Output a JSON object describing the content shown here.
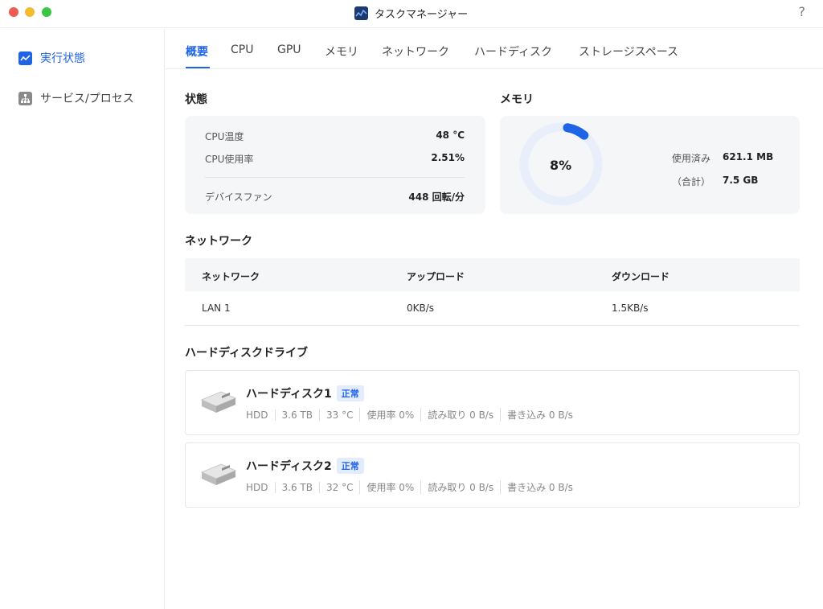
{
  "window": {
    "title": "タスクマネージャー",
    "help": "?"
  },
  "sidebar": {
    "items": [
      {
        "label": "実行状態",
        "active": true
      },
      {
        "label": "サービス/プロセス",
        "active": false
      }
    ]
  },
  "tabs": [
    "概要",
    "CPU",
    "GPU",
    "メモリ",
    "ネットワーク",
    "ハードディスク",
    "ストレージスペース"
  ],
  "status": {
    "title": "状態",
    "rows": [
      {
        "label": "CPU温度",
        "value": "48 °C"
      },
      {
        "label": "CPU使用率",
        "value": "2.51%"
      },
      {
        "label": "デバイスファン",
        "value": "448 回転/分"
      }
    ]
  },
  "memory": {
    "title": "メモリ",
    "percent_label": "8%",
    "percent": 0.08,
    "used_label": "使用済み",
    "used_value": "621.1 MB",
    "total_label": "（合計）",
    "total_value": "7.5 GB",
    "ring_color": "#1f63e6",
    "track_color": "#e8eefa"
  },
  "network": {
    "title": "ネットワーク",
    "headers": [
      "ネットワーク",
      "アップロード",
      "ダウンロード"
    ],
    "rows": [
      [
        "LAN 1",
        "0KB/s",
        "1.5KB/s"
      ]
    ]
  },
  "disks": {
    "title": "ハードディスクドライブ",
    "items": [
      {
        "name": "ハードディスク1",
        "status": "正常",
        "meta": [
          "HDD",
          "3.6 TB",
          "33 °C",
          "使用率 0%",
          "読み取り 0 B/s",
          "書き込み 0 B/s"
        ]
      },
      {
        "name": "ハードディスク2",
        "status": "正常",
        "meta": [
          "HDD",
          "3.6 TB",
          "32 °C",
          "使用率 0%",
          "読み取り 0 B/s",
          "書き込み 0 B/s"
        ]
      }
    ]
  }
}
